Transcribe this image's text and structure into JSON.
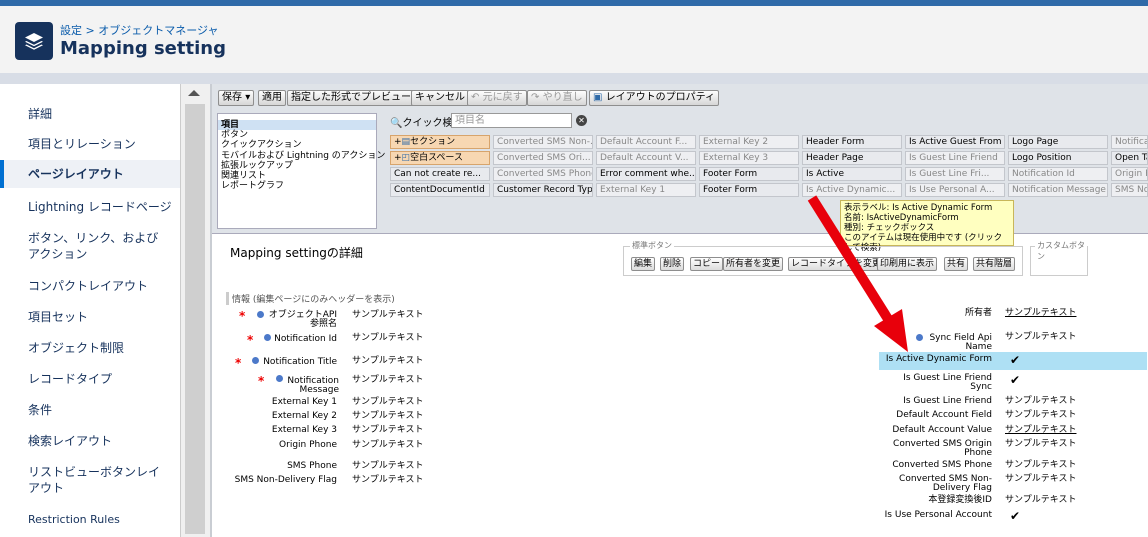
{
  "header": {
    "breadcrumb": "設定 > オブジェクトマネージャ",
    "title": "Mapping setting"
  },
  "sidebar": {
    "items": [
      {
        "label": "詳細"
      },
      {
        "label": "項目とリレーション"
      },
      {
        "label": "ページレイアウト"
      },
      {
        "label": "Lightning レコードページ"
      },
      {
        "label": "ボタン、リンク、およびアクション"
      },
      {
        "label": "コンパクトレイアウト"
      },
      {
        "label": "項目セット"
      },
      {
        "label": "オブジェクト制限"
      },
      {
        "label": "レコードタイプ"
      },
      {
        "label": "条件"
      },
      {
        "label": "検索レイアウト"
      },
      {
        "label": "リストビューボタンレイアウト"
      },
      {
        "label": "Restriction Rules"
      }
    ]
  },
  "toolbar": {
    "save": "保存",
    "apply": "適用",
    "preview": "指定した形式でプレビュー...",
    "cancel": "キャンセル",
    "undo": "元に戻す",
    "redo": "やり直し",
    "layout_props": "レイアウトのプロパティ"
  },
  "palette": {
    "categories": [
      "項目",
      "ボタン",
      "クイックアクション",
      "モバイルおよび Lightning のアクション",
      "拡張ルックアップ",
      "関連リスト",
      "レポートグラフ"
    ],
    "quick_find_label": "クイック検索",
    "quick_find_placeholder": "項目名",
    "fields": [
      "セクション",
      "Converted SMS Non-...",
      "Default Account F...",
      "External Key 2",
      "Header Form",
      "Is Active Guest From",
      "Logo Page",
      "Notificat",
      "空白スペース",
      "Converted SMS Ori...",
      "Default Account V...",
      "External Key 3",
      "Header Page",
      "Is Guest Line Friend",
      "Logo Position",
      "Open Ta",
      "Can not create re...",
      "Converted SMS Phone",
      "Error comment whe...",
      "Footer Form",
      "Is Active",
      "Is Guest Line Fri...",
      "Notification Id",
      "Origin Ph",
      "ContentDocumentId",
      "Customer Record Type",
      "External Key 1",
      "Footer Form",
      "Is Active Dynamic...",
      "Is Use Personal A...",
      "Notification Message",
      "SMS Non"
    ]
  },
  "tooltip": {
    "line1": "表示ラベル: Is Active Dynamic Form",
    "line2": "名前: IsActiveDynamicForm",
    "line3": "種別: チェックボックス",
    "line4": "このアイテムは現在使用中です (クリックして検索)"
  },
  "detail": {
    "title": "Mapping settingの詳細",
    "std_buttons_label": "標準ボタン",
    "custom_buttons_label": "カスタムボタン",
    "buttons": [
      "編集",
      "削除",
      "コピー",
      "所有者を変更",
      "レコードタイプを変更",
      "印刷用に表示",
      "共有",
      "共有階層"
    ],
    "section_header": "情報 (編集ページにのみヘッダーを表示)",
    "left": [
      {
        "label": "オブジェクトAPI参照名",
        "value": "サンプルテキスト"
      },
      {
        "label": "Notification Id",
        "value": "サンプルテキスト"
      },
      {
        "label": "Notification Title",
        "value": "サンプルテキスト"
      },
      {
        "label": "Notification Message",
        "value": "サンプルテキスト"
      },
      {
        "label": "External Key 1",
        "value": "サンプルテキスト"
      },
      {
        "label": "External Key 2",
        "value": "サンプルテキスト"
      },
      {
        "label": "External Key 3",
        "value": "サンプルテキスト"
      },
      {
        "label": "Origin Phone",
        "value": "サンプルテキスト"
      },
      {
        "label": "SMS Phone",
        "value": "サンプルテキスト"
      },
      {
        "label": "SMS Non-Delivery Flag",
        "value": "サンプルテキスト"
      }
    ],
    "right": [
      {
        "label": "所有者",
        "value": "サンプルテキスト"
      },
      {
        "label": "Sync Field Api Name",
        "value": "サンプルテキスト"
      },
      {
        "label": "Is Active Dynamic Form",
        "value": "✔"
      },
      {
        "label": "Is Guest Line Friend Sync",
        "value": "✔"
      },
      {
        "label": "Is Guest Line Friend",
        "value": "サンプルテキスト"
      },
      {
        "label": "Default Account Field",
        "value": "サンプルテキスト"
      },
      {
        "label": "Default Account Value",
        "value": "サンプルテキスト"
      },
      {
        "label": "Converted SMS Origin Phone",
        "value": "サンプルテキスト"
      },
      {
        "label": "Converted SMS Phone",
        "value": "サンプルテキスト"
      },
      {
        "label": "Converted SMS Non-Delivery Flag",
        "value": "サンプルテキスト"
      },
      {
        "label": "本登録変換後ID",
        "value": "サンプルテキスト"
      },
      {
        "label": "Is Use Personal Account",
        "value": "✔"
      }
    ]
  },
  "colors": {
    "accent": "#0070d2",
    "highlight": "#aee0f4",
    "arrow": "#e8000b"
  }
}
